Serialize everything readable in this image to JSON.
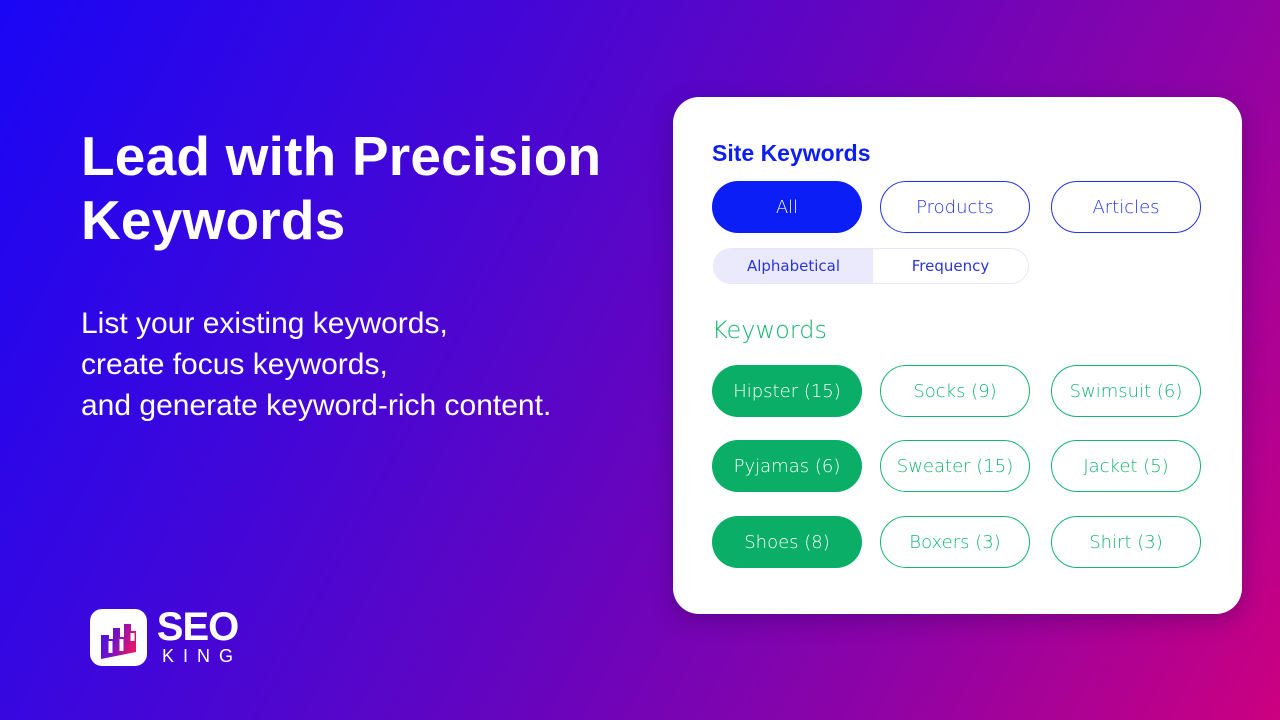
{
  "hero": {
    "headline_lines": [
      "Lead with Precision",
      "Keywords"
    ],
    "subtext_lines": [
      "List your existing keywords,",
      "create focus keywords,",
      "and generate keyword-rich content."
    ]
  },
  "logo": {
    "brand_top": "SEO",
    "brand_bottom": "KING",
    "icon": "bar-chart-logo-icon"
  },
  "card": {
    "title": "Site Keywords",
    "filters": [
      {
        "label": "All",
        "active": true
      },
      {
        "label": "Products",
        "active": false
      },
      {
        "label": "Articles",
        "active": false
      }
    ],
    "sort": [
      {
        "label": "Alphabetical",
        "active": true
      },
      {
        "label": "Frequency",
        "active": false
      }
    ],
    "keywords_title": "Keywords",
    "keywords": [
      {
        "label": "Hipster (15)",
        "selected": true
      },
      {
        "label": "Socks (9)",
        "selected": false
      },
      {
        "label": "Swimsuit (6)",
        "selected": false
      },
      {
        "label": "Pyjamas (6)",
        "selected": true
      },
      {
        "label": "Sweater (15)",
        "selected": false
      },
      {
        "label": "Jacket (5)",
        "selected": false
      },
      {
        "label": "Shoes (8)",
        "selected": true
      },
      {
        "label": "Boxers (3)",
        "selected": false
      },
      {
        "label": "Shirt (3)",
        "selected": false
      }
    ]
  },
  "colors": {
    "primary_blue": "#0a1ef5",
    "keyword_green": "#0aae66",
    "bg_gradient_start": "#1a06f5",
    "bg_gradient_end": "#cc0080"
  }
}
